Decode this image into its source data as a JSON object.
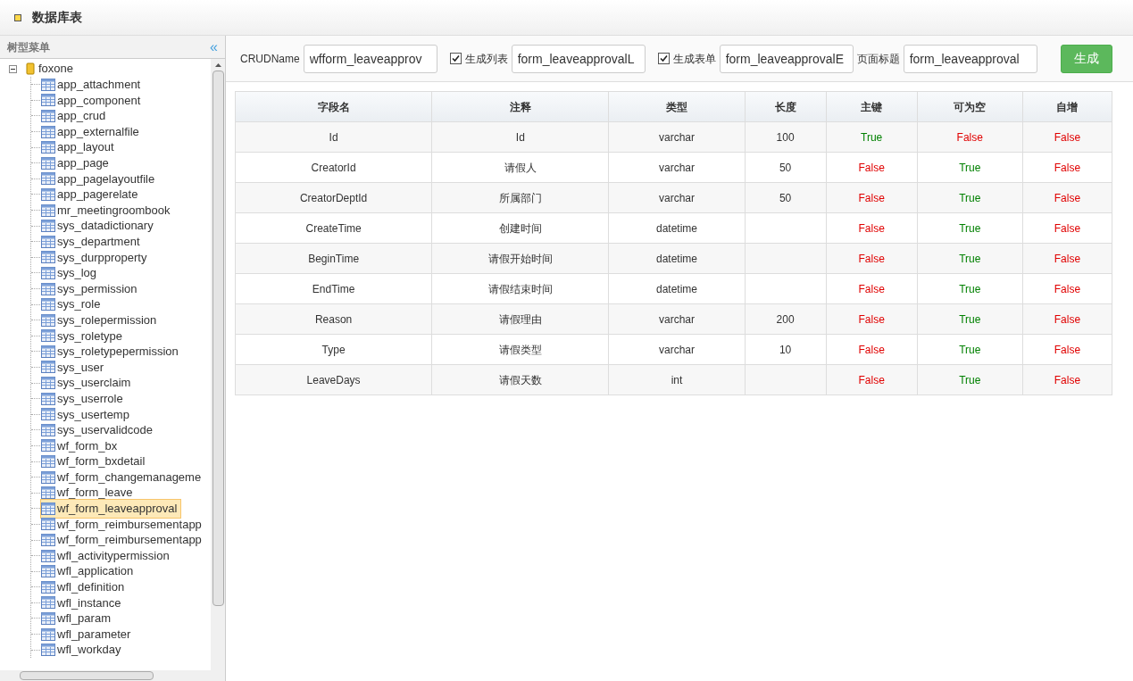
{
  "window": {
    "title": "数据库表"
  },
  "sidebar": {
    "title": "树型菜单",
    "collapse": "«",
    "tree": [
      {
        "label": "foxone",
        "expanded": true,
        "children": [
          {
            "label": "app_attachment",
            "selected": false
          },
          {
            "label": "app_component",
            "selected": false
          },
          {
            "label": "app_crud",
            "selected": false
          },
          {
            "label": "app_externalfile",
            "selected": false
          },
          {
            "label": "app_layout",
            "selected": false
          },
          {
            "label": "app_page",
            "selected": false
          },
          {
            "label": "app_pagelayoutfile",
            "selected": false
          },
          {
            "label": "app_pagerelate",
            "selected": false
          },
          {
            "label": "mr_meetingroombook",
            "selected": false
          },
          {
            "label": "sys_datadictionary",
            "selected": false
          },
          {
            "label": "sys_department",
            "selected": false
          },
          {
            "label": "sys_durpproperty",
            "selected": false
          },
          {
            "label": "sys_log",
            "selected": false
          },
          {
            "label": "sys_permission",
            "selected": false
          },
          {
            "label": "sys_role",
            "selected": false
          },
          {
            "label": "sys_rolepermission",
            "selected": false
          },
          {
            "label": "sys_roletype",
            "selected": false
          },
          {
            "label": "sys_roletypepermission",
            "selected": false
          },
          {
            "label": "sys_user",
            "selected": false
          },
          {
            "label": "sys_userclaim",
            "selected": false
          },
          {
            "label": "sys_userrole",
            "selected": false
          },
          {
            "label": "sys_usertemp",
            "selected": false
          },
          {
            "label": "sys_uservalidcode",
            "selected": false
          },
          {
            "label": "wf_form_bx",
            "selected": false
          },
          {
            "label": "wf_form_bxdetail",
            "selected": false
          },
          {
            "label": "wf_form_changemanageme",
            "selected": false
          },
          {
            "label": "wf_form_leave",
            "selected": false
          },
          {
            "label": "wf_form_leaveapproval",
            "selected": true
          },
          {
            "label": "wf_form_reimbursementapp",
            "selected": false
          },
          {
            "label": "wf_form_reimbursementapp",
            "selected": false
          },
          {
            "label": "wfl_activitypermission",
            "selected": false
          },
          {
            "label": "wfl_application",
            "selected": false
          },
          {
            "label": "wfl_definition",
            "selected": false
          },
          {
            "label": "wfl_instance",
            "selected": false
          },
          {
            "label": "wfl_param",
            "selected": false
          },
          {
            "label": "wfl_parameter",
            "selected": false
          },
          {
            "label": "wfl_workday",
            "selected": false
          }
        ]
      }
    ]
  },
  "toolbar": {
    "crud_label": "CRUDName",
    "crud_value": "wfform_leaveapprov",
    "list_label": "生成列表",
    "list_checked": true,
    "list_value": "form_leaveapprovalL",
    "form_label": "生成表单",
    "form_checked": true,
    "form_value": "form_leaveapprovalE",
    "title_label": "页面标题",
    "title_value": "form_leaveapproval",
    "generate": "生成"
  },
  "table": {
    "columns": [
      "字段名",
      "注释",
      "类型",
      "长度",
      "主键",
      "可为空",
      "自增"
    ],
    "rows": [
      {
        "cells": [
          "Id",
          "Id",
          "varchar",
          "100"
        ],
        "flags": [
          {
            "text": "True",
            "positive": true
          },
          {
            "text": "False",
            "positive": false
          },
          {
            "text": "False",
            "positive": false
          }
        ]
      },
      {
        "cells": [
          "CreatorId",
          "请假人",
          "varchar",
          "50"
        ],
        "flags": [
          {
            "text": "False",
            "positive": false
          },
          {
            "text": "True",
            "positive": true
          },
          {
            "text": "False",
            "positive": false
          }
        ]
      },
      {
        "cells": [
          "CreatorDeptId",
          "所属部门",
          "varchar",
          "50"
        ],
        "flags": [
          {
            "text": "False",
            "positive": false
          },
          {
            "text": "True",
            "positive": true
          },
          {
            "text": "False",
            "positive": false
          }
        ]
      },
      {
        "cells": [
          "CreateTime",
          "创建时间",
          "datetime",
          ""
        ],
        "flags": [
          {
            "text": "False",
            "positive": false
          },
          {
            "text": "True",
            "positive": true
          },
          {
            "text": "False",
            "positive": false
          }
        ]
      },
      {
        "cells": [
          "BeginTime",
          "请假开始时间",
          "datetime",
          ""
        ],
        "flags": [
          {
            "text": "False",
            "positive": false
          },
          {
            "text": "True",
            "positive": true
          },
          {
            "text": "False",
            "positive": false
          }
        ]
      },
      {
        "cells": [
          "EndTime",
          "请假结束时间",
          "datetime",
          ""
        ],
        "flags": [
          {
            "text": "False",
            "positive": false
          },
          {
            "text": "True",
            "positive": true
          },
          {
            "text": "False",
            "positive": false
          }
        ]
      },
      {
        "cells": [
          "Reason",
          "请假理由",
          "varchar",
          "200"
        ],
        "flags": [
          {
            "text": "False",
            "positive": false
          },
          {
            "text": "True",
            "positive": true
          },
          {
            "text": "False",
            "positive": false
          }
        ]
      },
      {
        "cells": [
          "Type",
          "请假类型",
          "varchar",
          "10"
        ],
        "flags": [
          {
            "text": "False",
            "positive": false
          },
          {
            "text": "True",
            "positive": true
          },
          {
            "text": "False",
            "positive": false
          }
        ]
      },
      {
        "cells": [
          "LeaveDays",
          "请假天数",
          "int",
          ""
        ],
        "flags": [
          {
            "text": "False",
            "positive": false
          },
          {
            "text": "True",
            "positive": true
          },
          {
            "text": "False",
            "positive": false
          }
        ]
      }
    ]
  }
}
